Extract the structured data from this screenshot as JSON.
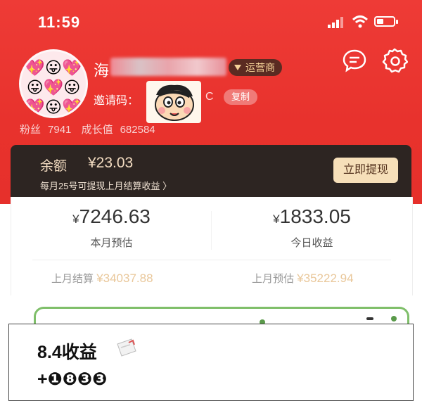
{
  "status": {
    "time": "11:59"
  },
  "profile": {
    "avatar_emoji": "💖😛💖😛💖😛💖😛💖😛💖😛",
    "name_prefix": "海",
    "badge": "运营商",
    "invite_label": "邀请码：",
    "invite_code_end": "C",
    "copy_label": "复制",
    "fans_label": "粉丝",
    "fans_value": "7941",
    "growth_label": "成长值",
    "growth_value": "682584"
  },
  "balance": {
    "label": "余额",
    "value": "¥23.03",
    "note": "每月25号可提现上月结算收益 〉",
    "withdraw_label": "立即提现"
  },
  "earnings": {
    "month_yen": "¥",
    "month_value": "7246.63",
    "month_label": "本月预估",
    "today_yen": "¥",
    "today_value": "1833.05",
    "today_label": "今日收益",
    "last_settle_label": "上月结算",
    "last_settle_value": "¥34037.88",
    "last_estimate_label": "上月预估",
    "last_estimate_value": "¥35222.94"
  },
  "overlay": {
    "title": "8.4收益",
    "amount": "+❶❽❸❸"
  },
  "colors": {
    "brand_red": "#e8322d",
    "gold": "#f6dfb9",
    "dark": "#2d2522"
  }
}
